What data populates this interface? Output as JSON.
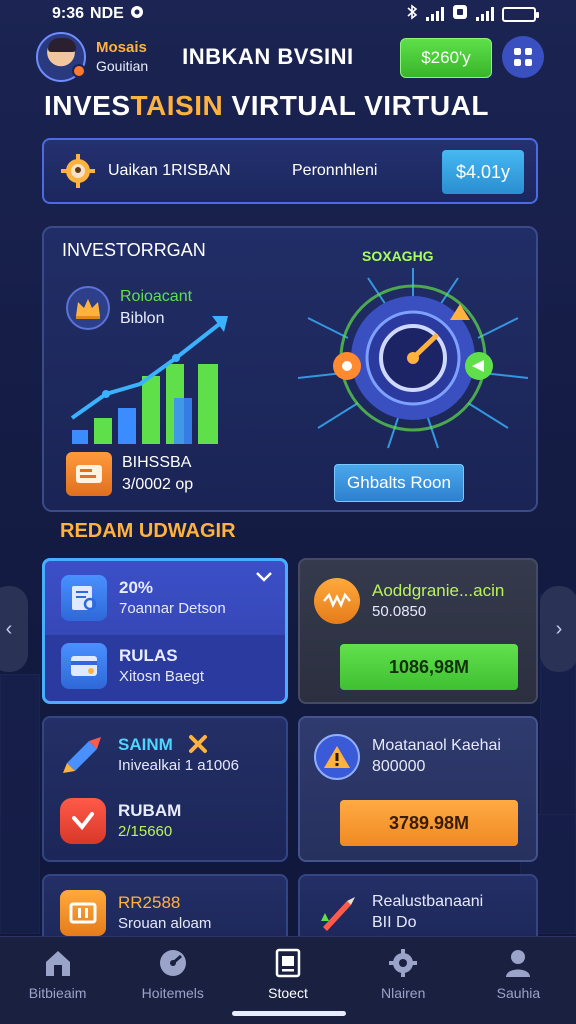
{
  "status_bar": {
    "time": "9:36",
    "left_icons": "NDE"
  },
  "header": {
    "user_name": "Mosais",
    "user_sub": "Gouitian",
    "app_title": "INBKAN BVSINI",
    "balance_label": "$260'y"
  },
  "page_title": {
    "part1": "INVES",
    "highlight": "TAISIN",
    "part2": " VIRTUAL VIRTUAL"
  },
  "info_bar": {
    "label": "Uaikan 1RISBAN",
    "status": "Peronnhleni",
    "button": "$4.01y"
  },
  "invest_panel": {
    "title": "INVESTORRGAN",
    "portfolio_name": "Roioacant",
    "portfolio_sub": "Biblon",
    "stats_name": "BIHSSBA",
    "stats_value": "3/0002 op",
    "hub_label": "SOXAGHG",
    "hub_button": "Ghbalts Roon"
  },
  "section_title": "REDAM UDWAGIR",
  "cards": {
    "c1": {
      "row1_title": "20%",
      "row1_sub": "7oannar Detson",
      "row2_title": "RULAS",
      "row2_sub": "Xitosn Baegt"
    },
    "c2": {
      "title": "Aoddgranie...acin",
      "sub": "50.0850",
      "button": "1086,98M"
    },
    "c3": {
      "row1_title": "SAINM",
      "row1_sub": "Inivealkai 1 a1006",
      "row2_title": "RUBAM",
      "row2_sub": "2/15660"
    },
    "c4": {
      "title": "Moatanaol Kaehai",
      "sub": "800000",
      "button": "3789.98M"
    },
    "c5": {
      "title": "RR2588",
      "sub": "Srouan aloam"
    },
    "c6": {
      "title": "Realustbanaani",
      "sub": "BII Do"
    }
  },
  "bottom_nav": [
    "Bitbieaim",
    "Hoitemels",
    "Stoect",
    "Nlairen",
    "Sauhia"
  ],
  "colors": {
    "accent_orange": "#ffb23e",
    "accent_green": "#5fe04a",
    "accent_blue": "#4aaeff",
    "background": "#1b2452"
  }
}
